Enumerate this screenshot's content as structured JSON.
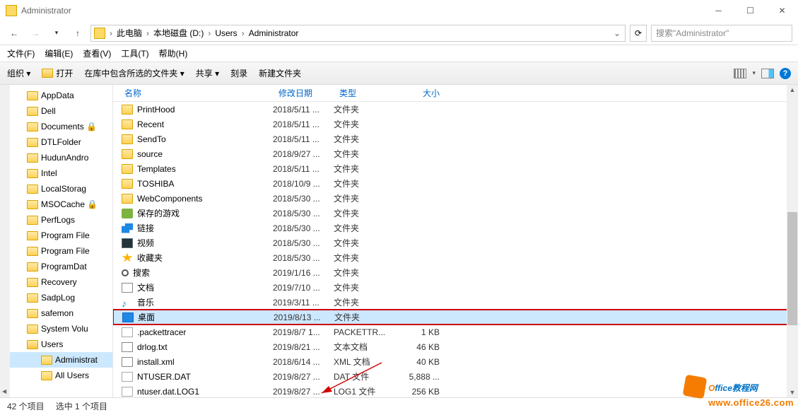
{
  "window": {
    "title": "Administrator"
  },
  "breadcrumbs": [
    "此电脑",
    "本地磁盘 (D:)",
    "Users",
    "Administrator"
  ],
  "search": {
    "placeholder": "搜索\"Administrator\""
  },
  "menu": {
    "file": "文件(F)",
    "edit": "编辑(E)",
    "view": "查看(V)",
    "tools": "工具(T)",
    "help": "帮助(H)"
  },
  "toolbar": {
    "organize": "组织 ▾",
    "open": "打开",
    "include": "在库中包含所选的文件夹 ▾",
    "share": "共享 ▾",
    "burn": "刻录",
    "newfolder": "新建文件夹"
  },
  "columns": {
    "name": "名称",
    "date": "修改日期",
    "type": "类型",
    "size": "大小"
  },
  "tree": [
    {
      "label": "AppData",
      "sel": false
    },
    {
      "label": "Dell",
      "sel": false
    },
    {
      "label": "Documents 🔒",
      "sel": false
    },
    {
      "label": "DTLFolder",
      "sel": false
    },
    {
      "label": "HudunAndro",
      "sel": false
    },
    {
      "label": "Intel",
      "sel": false
    },
    {
      "label": "LocalStorag",
      "sel": false
    },
    {
      "label": "MSOCache 🔒",
      "sel": false
    },
    {
      "label": "PerfLogs",
      "sel": false
    },
    {
      "label": "Program File",
      "sel": false
    },
    {
      "label": "Program File",
      "sel": false
    },
    {
      "label": "ProgramDat",
      "sel": false
    },
    {
      "label": "Recovery",
      "sel": false
    },
    {
      "label": "SadpLog",
      "sel": false
    },
    {
      "label": "safemon",
      "sel": false
    },
    {
      "label": "System Volu",
      "sel": false
    },
    {
      "label": "Users",
      "sel": false,
      "open": true
    },
    {
      "label": "Administrat",
      "sel": true,
      "indent": true
    },
    {
      "label": "All Users",
      "sel": false,
      "indent": true
    }
  ],
  "files": [
    {
      "name": "PrintHood",
      "date": "2018/5/11 ...",
      "type": "文件夹",
      "size": "",
      "ico": "folder"
    },
    {
      "name": "Recent",
      "date": "2018/5/11 ...",
      "type": "文件夹",
      "size": "",
      "ico": "folder"
    },
    {
      "name": "SendTo",
      "date": "2018/5/11 ...",
      "type": "文件夹",
      "size": "",
      "ico": "folder"
    },
    {
      "name": "source",
      "date": "2018/9/27 ...",
      "type": "文件夹",
      "size": "",
      "ico": "folder"
    },
    {
      "name": "Templates",
      "date": "2018/5/11 ...",
      "type": "文件夹",
      "size": "",
      "ico": "folder"
    },
    {
      "name": "TOSHIBA",
      "date": "2018/10/9 ...",
      "type": "文件夹",
      "size": "",
      "ico": "folder"
    },
    {
      "name": "WebComponents",
      "date": "2018/5/30 ...",
      "type": "文件夹",
      "size": "",
      "ico": "folder"
    },
    {
      "name": "保存的游戏",
      "date": "2018/5/30 ...",
      "type": "文件夹",
      "size": "",
      "ico": "game"
    },
    {
      "name": "链接",
      "date": "2018/5/30 ...",
      "type": "文件夹",
      "size": "",
      "ico": "link"
    },
    {
      "name": "视频",
      "date": "2018/5/30 ...",
      "type": "文件夹",
      "size": "",
      "ico": "video"
    },
    {
      "name": "收藏夹",
      "date": "2018/5/30 ...",
      "type": "文件夹",
      "size": "",
      "ico": "fav"
    },
    {
      "name": "搜索",
      "date": "2019/1/16 ...",
      "type": "文件夹",
      "size": "",
      "ico": "search"
    },
    {
      "name": "文档",
      "date": "2019/7/10 ...",
      "type": "文件夹",
      "size": "",
      "ico": "doc"
    },
    {
      "name": "音乐",
      "date": "2019/3/11 ...",
      "type": "文件夹",
      "size": "",
      "ico": "music"
    },
    {
      "name": "桌面",
      "date": "2019/8/13 ...",
      "type": "文件夹",
      "size": "",
      "ico": "desktop",
      "selected": true,
      "highlighted": true
    },
    {
      "name": ".packettracer",
      "date": "2019/8/7 1...",
      "type": "PACKETTR...",
      "size": "1 KB",
      "ico": "file"
    },
    {
      "name": "drlog.txt",
      "date": "2019/8/21 ...",
      "type": "文本文档",
      "size": "46 KB",
      "ico": "doc"
    },
    {
      "name": "install.xml",
      "date": "2018/6/14 ...",
      "type": "XML 文档",
      "size": "40 KB",
      "ico": "xml"
    },
    {
      "name": "NTUSER.DAT",
      "date": "2019/8/27 ...",
      "type": "DAT 文件",
      "size": "5,888 ...",
      "ico": "file"
    },
    {
      "name": "ntuser.dat.LOG1",
      "date": "2019/8/27 ...",
      "type": "LOG1 文件",
      "size": "256 KB",
      "ico": "file"
    }
  ],
  "status": {
    "count": "42 个项目",
    "selected": "选中 1 个项目"
  },
  "watermark": {
    "line1a": "O",
    "line1b": "ffice教程网",
    "line2": "www.office26.com"
  }
}
